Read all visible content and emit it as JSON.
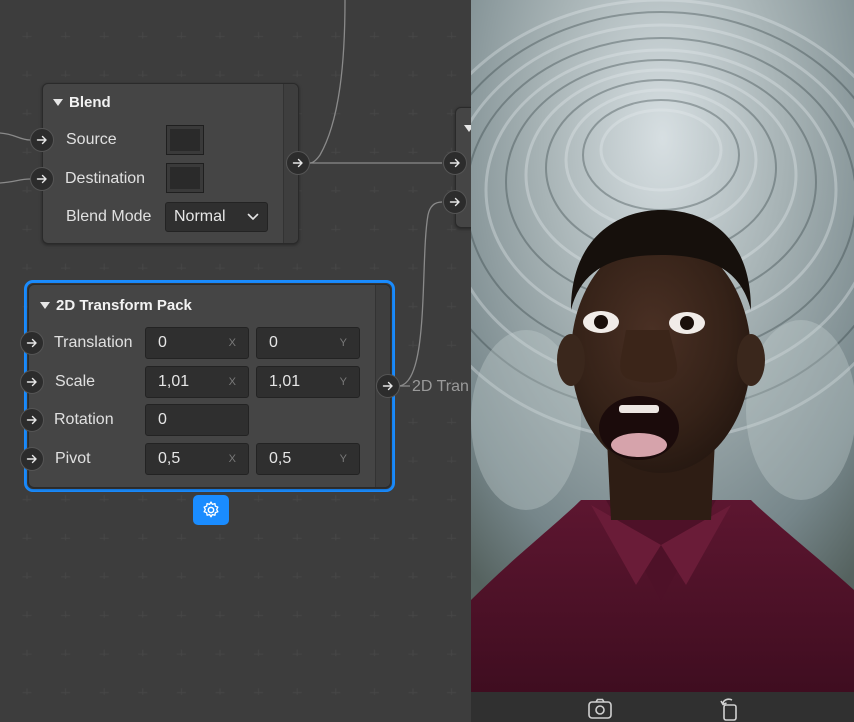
{
  "blend_node": {
    "title": "Blend",
    "source_label": "Source",
    "destination_label": "Destination",
    "blend_mode_label": "Blend Mode",
    "blend_mode_value": "Normal"
  },
  "transform_node": {
    "title": "2D Transform Pack",
    "translation_label": "Translation",
    "translation_x": "0",
    "translation_y": "0",
    "scale_label": "Scale",
    "scale_x": "1,01",
    "scale_y": "1,01",
    "rotation_label": "Rotation",
    "rotation_value": "0",
    "pivot_label": "Pivot",
    "pivot_x": "0,5",
    "pivot_y": "0,5",
    "axis_x": "X",
    "axis_y": "Y",
    "output_label": "2D Tran"
  },
  "colors": {
    "selection": "#1a8cff",
    "node_bg": "#454545",
    "canvas_bg": "#313131"
  },
  "icons": {
    "port": "arrow-right-icon",
    "settings": "gear-icon",
    "dropdown": "chevron-down-icon",
    "switch_camera": "switch-camera-icon",
    "rotate": "rotate-icon"
  }
}
